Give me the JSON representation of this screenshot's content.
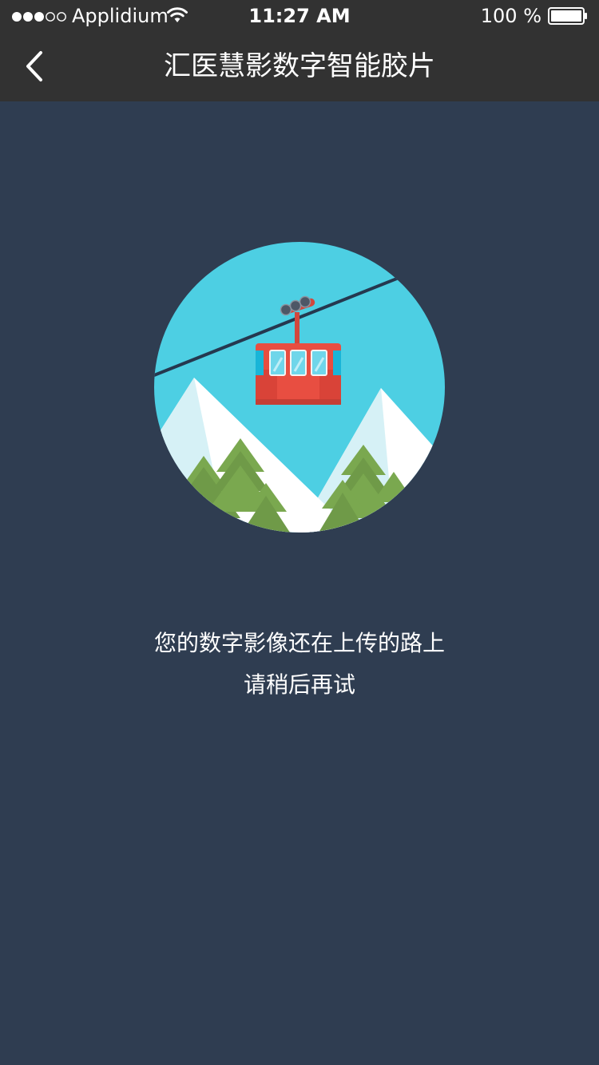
{
  "status_bar": {
    "carrier": "Applidium",
    "time": "11:27 AM",
    "battery_percent": "100 %",
    "signal_icon": "signal-dots-icon",
    "wifi_icon": "wifi-icon",
    "battery_icon": "battery-icon"
  },
  "nav": {
    "title": "汇医慧影数字智能胶片",
    "back_icon": "chevron-left-icon"
  },
  "illustration": {
    "name": "cable-car-illustration"
  },
  "message": {
    "line1": "您的数字影像还在上传的路上",
    "line2": "请稍后再试"
  },
  "colors": {
    "header_bg": "#323232",
    "page_bg": "#2f3d51",
    "sky": "#4dcfe3",
    "cabin": "#e84e41",
    "tree": "#7aa84f"
  }
}
